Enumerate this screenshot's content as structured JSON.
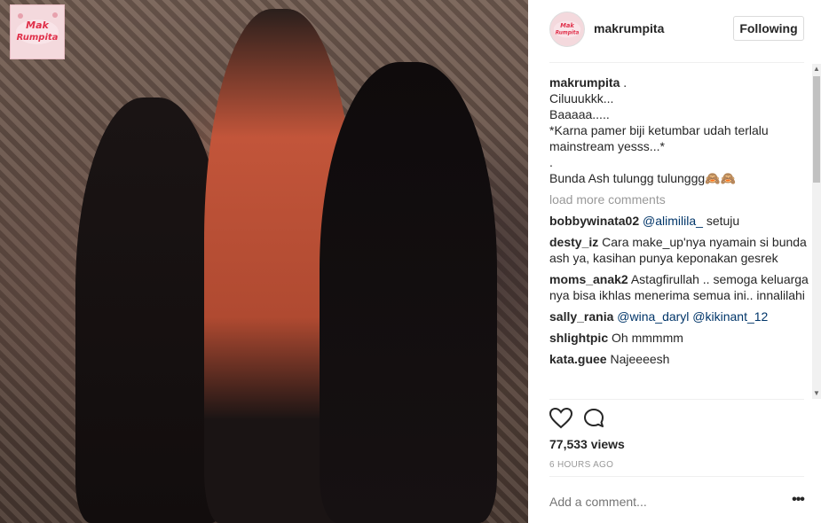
{
  "media": {
    "logo_text": "Mak Rumpita"
  },
  "header": {
    "username": "makrumpita",
    "follow_label": "Following"
  },
  "caption": {
    "user": "makrumpita",
    "lines": [
      ".",
      "Ciluuukkk...",
      "Baaaaa.....",
      "*Karna pamer biji ketumbar udah terlalu mainstream yesss...*",
      ".",
      "Bunda Ash tulungg tulunggg🙈🙈"
    ]
  },
  "load_more": "load more comments",
  "comments": [
    {
      "user": "bobbywinata02",
      "mention": "@alimilila_",
      "text": "setuju"
    },
    {
      "user": "desty_iz",
      "mention": "",
      "text": "Cara make_up'nya nyamain si bunda ash ya, kasihan punya keponakan gesrek"
    },
    {
      "user": "moms_anak2",
      "mention": "",
      "text": "Astagfirullah .. semoga keluarga nya bisa ikhlas menerima semua ini.. innalilahi"
    },
    {
      "user": "sally_rania",
      "mention": "@wina_daryl @kikinant_12",
      "text": ""
    },
    {
      "user": "shlightpic",
      "mention": "",
      "text": "Oh mmmmm"
    },
    {
      "user": "kata.guee",
      "mention": "",
      "text": "Najeeeesh"
    }
  ],
  "stats": {
    "views": "77,533 views",
    "time": "6 HOURS AGO"
  },
  "add_comment": {
    "placeholder": "Add a comment..."
  },
  "more_options": "•••",
  "icons": {
    "like": "heart-icon",
    "comment": "speech-bubble-icon",
    "more": "more-options-icon"
  },
  "colors": {
    "mention": "#003569",
    "muted": "#999999",
    "text": "#262626",
    "logo_pink": "#e0304a"
  }
}
